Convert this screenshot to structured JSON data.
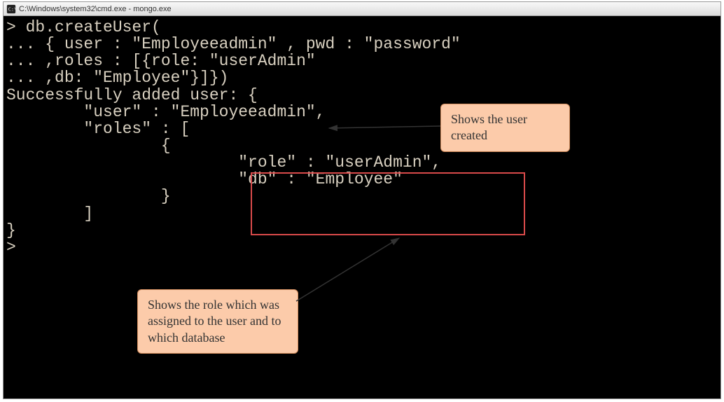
{
  "window": {
    "title": "C:\\Windows\\system32\\cmd.exe - mongo.exe"
  },
  "terminal": {
    "l1": "> db.createUser(",
    "l2": "... { user : \"Employeeadmin\" , pwd : \"password\"",
    "l3": "... ,roles : [{role: \"userAdmin\"",
    "l4": "... ,db: \"Employee\"}]})",
    "l5": "Successfully added user: {",
    "l6": "        \"user\" : \"Employeeadmin\",",
    "l7": "        \"roles\" : [",
    "l8": "                {",
    "l9": "                        \"role\" : \"userAdmin\",",
    "l10": "                        \"db\" : \"Employee\"",
    "l11": "                }",
    "l12": "        ]",
    "l13": "}",
    "l14": ">"
  },
  "callouts": {
    "c1": "Shows the user created",
    "c2": "Shows the role which was assigned to the user and to which database"
  }
}
